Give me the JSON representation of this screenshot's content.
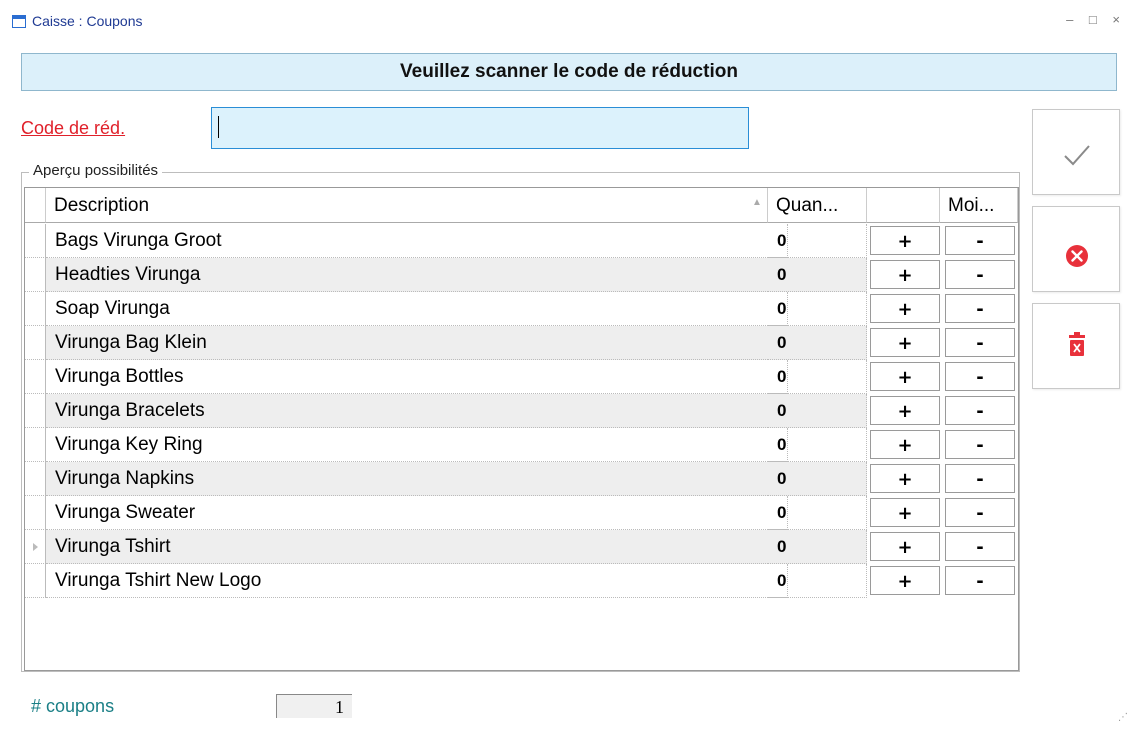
{
  "window": {
    "title": "Caisse : Coupons",
    "controls": "– □ ×"
  },
  "banner": {
    "text": "Veuillez scanner le code de réduction"
  },
  "code_field": {
    "label": "Code de réd.",
    "value": ""
  },
  "group": {
    "legend": "Aperçu possibilités"
  },
  "grid": {
    "columns": {
      "description": "Description",
      "quantity": "Quan...",
      "plus": "",
      "minus": "Moi..."
    },
    "plus_label": "+",
    "minus_label": "-",
    "rows": [
      {
        "description": "Bags Virunga Groot",
        "quantity": "0"
      },
      {
        "description": "Headties Virunga",
        "quantity": "0"
      },
      {
        "description": "Soap Virunga",
        "quantity": "0"
      },
      {
        "description": "Virunga Bag Klein",
        "quantity": "0"
      },
      {
        "description": "Virunga Bottles",
        "quantity": "0"
      },
      {
        "description": "Virunga Bracelets",
        "quantity": "0"
      },
      {
        "description": "Virunga Key Ring",
        "quantity": "0"
      },
      {
        "description": "Virunga Napkins",
        "quantity": "0"
      },
      {
        "description": "Virunga Sweater",
        "quantity": "0"
      },
      {
        "description": "Virunga Tshirt",
        "quantity": "0",
        "current": true
      },
      {
        "description": "Virunga Tshirt New Logo",
        "quantity": "0"
      }
    ]
  },
  "side_buttons": [
    {
      "name": "confirm",
      "icon": "checkmark-icon"
    },
    {
      "name": "cancel",
      "icon": "cancel-circle-icon",
      "color": "#e8313b"
    },
    {
      "name": "delete",
      "icon": "trash-icon",
      "color": "#e8313b"
    }
  ],
  "footer": {
    "coupons_label": "# coupons",
    "coupons_value": "1"
  }
}
